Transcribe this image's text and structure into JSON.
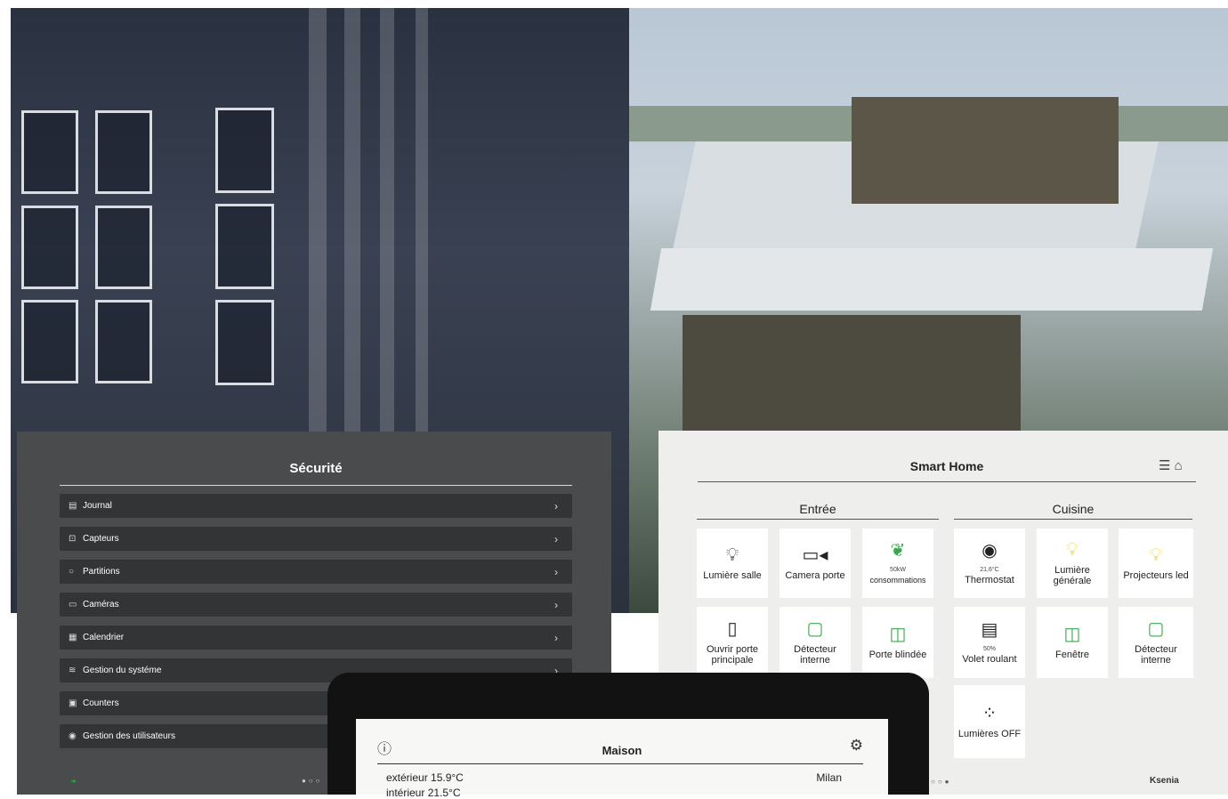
{
  "security": {
    "title": "Sécurité",
    "items": [
      {
        "label": "Journal",
        "icon": "document-icon"
      },
      {
        "label": "Capteurs",
        "icon": "lock-icon"
      },
      {
        "label": "Partitions",
        "icon": "circle-icon"
      },
      {
        "label": "Caméras",
        "icon": "camera-icon"
      },
      {
        "label": "Calendrier",
        "icon": "calendar-icon"
      },
      {
        "label": "Gestion du systéme",
        "icon": "wifi-icon"
      },
      {
        "label": "Counters",
        "icon": "counter-icon"
      },
      {
        "label": "Gestion des utilisateurs",
        "icon": "user-icon"
      }
    ],
    "chevron": "›",
    "pager_dots": "●○○"
  },
  "smart_home": {
    "title": "Smart Home",
    "sections": [
      {
        "title": "Entrée"
      },
      {
        "title": "Cuisine"
      }
    ],
    "tiles": {
      "lumiere_salle": {
        "label": "Lumière salle"
      },
      "camera_porte": {
        "label": "Camera porte"
      },
      "consommations": {
        "value": "50kW",
        "label": "consommations"
      },
      "thermostat": {
        "value": "21,6°C",
        "label": "Thermostat"
      },
      "lumiere_generale": {
        "label": "Lumière générale"
      },
      "projecteurs_led": {
        "label": "Projecteurs led"
      },
      "ouvrir_porte": {
        "label": "Ouvrir porte principale"
      },
      "detecteur_entree": {
        "label": "Détecteur interne"
      },
      "porte_blindee": {
        "label": "Porte blindée"
      },
      "volet_roulant": {
        "value": "50%",
        "label": "Volet roulant"
      },
      "fenetre": {
        "label": "Fenêtre"
      },
      "detecteur_cuisine": {
        "label": "Détecteur interne"
      },
      "lumieres_off": {
        "label": "Lumières OFF"
      }
    },
    "pager_dots": "○○●",
    "brand": "Ksenia"
  },
  "tablet": {
    "title": "Maison",
    "exterior": "extérieur 15.9°C",
    "interior": "intérieur 21.5°C",
    "city": "Milan"
  },
  "colors": {
    "accent_green": "#3aa84f",
    "accent_yellow": "#e6d23a",
    "security_bg": "#4a4b4d",
    "smart_bg": "#eeeeec"
  }
}
